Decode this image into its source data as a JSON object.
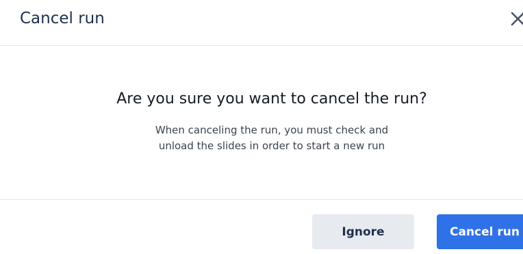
{
  "dialog": {
    "title": "Cancel run",
    "close_icon": "close-icon",
    "question": "Are you sure you want to cancel the run?",
    "description_line1": "When canceling the run, you must check and",
    "description_line2": "unload the slides in order to start a new run",
    "buttons": {
      "ignore_label": "Ignore",
      "cancel_run_label": "Cancel run"
    }
  },
  "colors": {
    "title": "#1e2f4d",
    "primary_button": "#2f72e8",
    "secondary_button": "#e7ebf0",
    "divider": "#e3e6ea"
  }
}
